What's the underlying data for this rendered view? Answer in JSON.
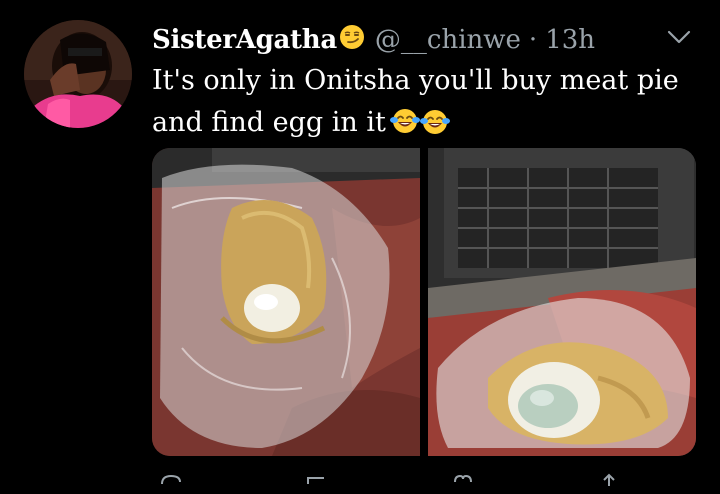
{
  "tweet": {
    "author": {
      "display_name": "SisterAgatha",
      "name_emoji": "smirking-face-emoji",
      "handle": "@__chinwe",
      "separator": "·",
      "timestamp": "13h"
    },
    "text": {
      "line1": "It's only in Onitsha you'll buy meat pie",
      "line2": "and find egg in it",
      "trailing_emojis": [
        "face-with-tears-of-joy-emoji",
        "face-with-tears-of-joy-emoji"
      ]
    },
    "menu_icon": "chevron-down-icon",
    "media": [
      {
        "subject": "meat pie with egg in plastic bag on red leather seat"
      },
      {
        "subject": "opened meat pie showing boiled egg in plastic bag"
      }
    ],
    "action_icons": [
      "reply-icon",
      "retweet-icon",
      "like-icon",
      "share-icon"
    ]
  },
  "colors": {
    "background": "#000000",
    "text_primary": "#ffffff",
    "text_secondary": "#9aa3aa"
  }
}
